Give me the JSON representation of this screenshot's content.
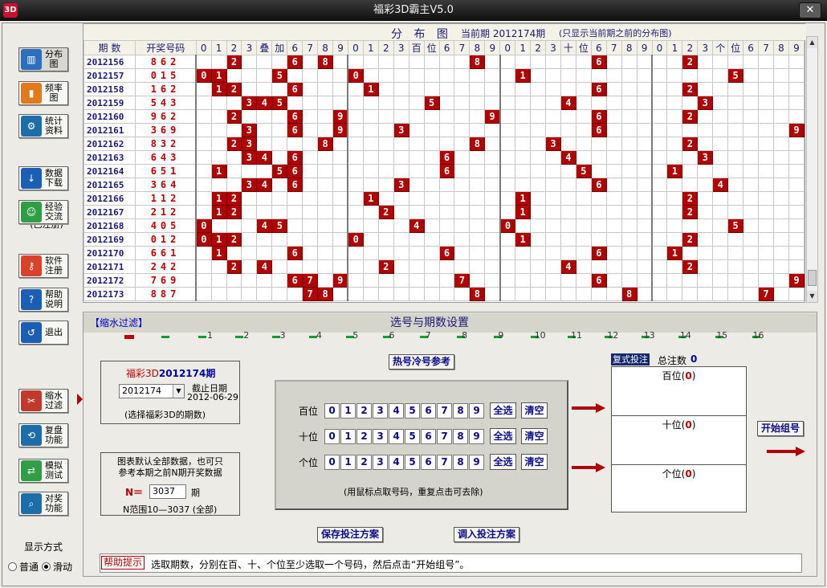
{
  "window": {
    "title": "福彩3D霸主V5.0",
    "close_glyph": "✕",
    "icon_text": "3D"
  },
  "sidebar": {
    "items": [
      {
        "label": "分布图",
        "icon": "chart-distribution-icon",
        "color": "#2d6fbf"
      },
      {
        "label": "频率图",
        "icon": "bar-chart-icon",
        "color": "#e07a1a"
      },
      {
        "label": "统计资料",
        "icon": "gear-stats-icon",
        "color": "#1d6ea8"
      },
      {
        "label": "数据下载",
        "icon": "download-icon",
        "color": "#1a5fb4"
      },
      {
        "label": "经验交流",
        "icon": "users-icon",
        "color": "#2f9e44"
      },
      {
        "label": "软件注册",
        "icon": "key-icon",
        "color": "#d9432b"
      },
      {
        "label": "帮助说明",
        "icon": "help-icon",
        "color": "#1a5fb4"
      },
      {
        "label": "退出",
        "icon": "exit-icon",
        "color": "#1a5fb4"
      },
      {
        "label": "缩水过滤",
        "icon": "scissors-icon",
        "color": "#c0392b"
      },
      {
        "label": "复盘功能",
        "icon": "replay-icon",
        "color": "#1d6ea8"
      },
      {
        "label": "模拟测试",
        "icon": "simulate-icon",
        "color": "#2f9e44"
      },
      {
        "label": "对奖功能",
        "icon": "magnifier-icon",
        "color": "#1d6ea8"
      }
    ],
    "registered": "(已注册)",
    "display_mode_label": "显示方式",
    "mode_normal": "普通",
    "mode_scroll": "滑动",
    "selected_mode": "滑动"
  },
  "grid": {
    "title": "分 布 图",
    "current_label": "当前期 2012174期",
    "note": "(只显示当前期之前的分布图)",
    "col_period": "期 数",
    "col_draw": "开奖号码",
    "sections": [
      [
        "0",
        "1",
        "2",
        "3",
        "叠",
        "加",
        "6",
        "7",
        "8",
        "9"
      ],
      [
        "0",
        "1",
        "2",
        "3",
        "百",
        "位",
        "6",
        "7",
        "8",
        "9"
      ],
      [
        "0",
        "1",
        "2",
        "3",
        "十",
        "位",
        "6",
        "7",
        "8",
        "9"
      ],
      [
        "0",
        "1",
        "2",
        "3",
        "个",
        "位",
        "6",
        "7",
        "8",
        "9"
      ]
    ],
    "rows": [
      {
        "period": "2012156",
        "draw": "862",
        "hits": [
          [
            "2",
            "6",
            "8"
          ],
          [
            "8"
          ],
          [
            "6"
          ],
          [
            "2"
          ]
        ]
      },
      {
        "period": "2012157",
        "draw": "015",
        "hits": [
          [
            "0",
            "1",
            "5"
          ],
          [
            "0"
          ],
          [
            "1"
          ],
          [
            "5"
          ]
        ]
      },
      {
        "period": "2012158",
        "draw": "162",
        "hits": [
          [
            "1",
            "2",
            "6"
          ],
          [
            "1"
          ],
          [
            "6"
          ],
          [
            "2"
          ]
        ]
      },
      {
        "period": "2012159",
        "draw": "543",
        "hits": [
          [
            "3",
            "4",
            "5"
          ],
          [
            "5"
          ],
          [
            "4"
          ],
          [
            "3"
          ]
        ]
      },
      {
        "period": "2012160",
        "draw": "962",
        "hits": [
          [
            "2",
            "6",
            "9"
          ],
          [
            "9"
          ],
          [
            "6"
          ],
          [
            "2"
          ]
        ]
      },
      {
        "period": "2012161",
        "draw": "369",
        "hits": [
          [
            "3",
            "6",
            "9"
          ],
          [
            "3"
          ],
          [
            "6"
          ],
          [
            "9"
          ]
        ]
      },
      {
        "period": "2012162",
        "draw": "832",
        "hits": [
          [
            "2",
            "3",
            "8"
          ],
          [
            "8"
          ],
          [
            "3"
          ],
          [
            "2"
          ]
        ]
      },
      {
        "period": "2012163",
        "draw": "643",
        "hits": [
          [
            "3",
            "4",
            "6"
          ],
          [
            "6"
          ],
          [
            "4"
          ],
          [
            "3"
          ]
        ]
      },
      {
        "period": "2012164",
        "draw": "651",
        "hits": [
          [
            "1",
            "5",
            "6"
          ],
          [
            "6"
          ],
          [
            "5"
          ],
          [
            "1"
          ]
        ]
      },
      {
        "period": "2012165",
        "draw": "364",
        "hits": [
          [
            "3",
            "4",
            "6"
          ],
          [
            "3"
          ],
          [
            "6"
          ],
          [
            "4"
          ]
        ]
      },
      {
        "period": "2012166",
        "draw": "112",
        "hits": [
          [
            "1",
            "2"
          ],
          [
            "1"
          ],
          [
            "1"
          ],
          [
            "2"
          ]
        ]
      },
      {
        "period": "2012167",
        "draw": "212",
        "hits": [
          [
            "1",
            "2"
          ],
          [
            "2"
          ],
          [
            "1"
          ],
          [
            "2"
          ]
        ]
      },
      {
        "period": "2012168",
        "draw": "405",
        "hits": [
          [
            "0",
            "4",
            "5"
          ],
          [
            "4"
          ],
          [
            "0"
          ],
          [
            "5"
          ]
        ]
      },
      {
        "period": "2012169",
        "draw": "012",
        "hits": [
          [
            "0",
            "1",
            "2"
          ],
          [
            "0"
          ],
          [
            "1"
          ],
          [
            "2"
          ]
        ]
      },
      {
        "period": "2012170",
        "draw": "661",
        "hits": [
          [
            "1",
            "6"
          ],
          [
            "6"
          ],
          [
            "6"
          ],
          [
            "1"
          ]
        ]
      },
      {
        "period": "2012171",
        "draw": "242",
        "hits": [
          [
            "2",
            "4"
          ],
          [
            "2"
          ],
          [
            "4"
          ],
          [
            "2"
          ]
        ]
      },
      {
        "period": "2012172",
        "draw": "769",
        "hits": [
          [
            "6",
            "7",
            "9"
          ],
          [
            "7"
          ],
          [
            "6"
          ],
          [
            "9"
          ]
        ]
      },
      {
        "period": "2012173",
        "draw": "887",
        "hits": [
          [
            "7",
            "8"
          ],
          [
            "8"
          ],
          [
            "8"
          ],
          [
            "7"
          ]
        ]
      }
    ]
  },
  "panel": {
    "filter_tag": "【缩水过滤】",
    "title": "选号与期数设置",
    "ruler_ticks": [
      "1",
      "2",
      "3",
      "4",
      "5",
      "6",
      "7",
      "8",
      "9",
      "10",
      "11",
      "12",
      "13",
      "14",
      "15",
      "16"
    ],
    "period_box": {
      "title_prefix": "福彩3D",
      "title_period": "2012174期",
      "select_value": "2012174",
      "deadline_label": "截止日期",
      "deadline_value": "2012-06-29",
      "hint": "(选择福彩3D的期数)"
    },
    "n_box": {
      "line1": "图表默认全部数据，也可只",
      "line2": "参考本期之前N期开奖数据",
      "n_label": "N＝",
      "n_value": "3037",
      "n_unit": "期",
      "range": "N范围10—3037 (全部)"
    },
    "hot_cold_btn": "热号冷号参考",
    "picker": {
      "rows": [
        "百位",
        "十位",
        "个位"
      ],
      "digits": [
        "0",
        "1",
        "2",
        "3",
        "4",
        "5",
        "6",
        "7",
        "8",
        "9"
      ],
      "select_all": "全选",
      "clear": "清空",
      "hint": "(用鼠标点取号码，重复点击可去除)"
    },
    "compound_label": "复式投注",
    "total_label": "总注数",
    "total_value": "0",
    "result_rows": [
      {
        "name": "百位",
        "count": "0"
      },
      {
        "name": "十位",
        "count": "0"
      },
      {
        "name": "个位",
        "count": "0"
      }
    ],
    "start_btn": "开始组号",
    "save_btn": "保存投注方案",
    "load_btn": "调入投注方案",
    "help_tag": "帮助提示",
    "help_text": "选取期数，分别在百、十、个位至少选取一个号码，然后点击“开始组号”。"
  },
  "colors": {
    "hit_cell": "#b00000",
    "header_text": "#1a1a7a",
    "draw_text": "#c00000",
    "accent_green": "#0a9e2a"
  }
}
